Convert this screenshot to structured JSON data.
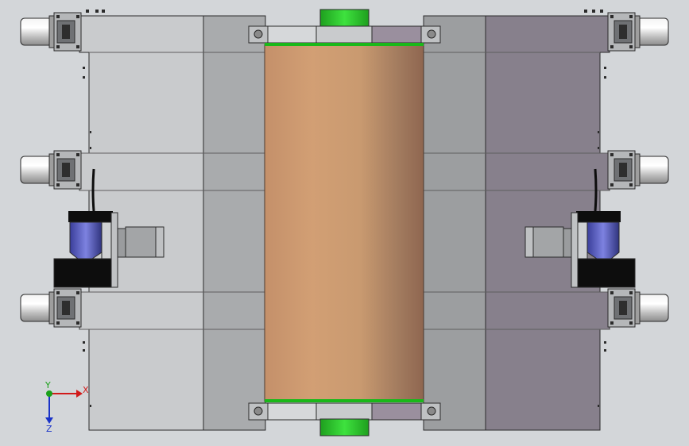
{
  "view": {
    "background": "#d3d6d9",
    "outline": "#2b2b2b"
  },
  "panels": {
    "left_outer": "#c9cbcd",
    "left_inner": "#a9abad",
    "right_inner": "#9c9ea0",
    "right_outer": "#87808c"
  },
  "roller": {
    "colors": [
      "#c4906a",
      "#d29f74",
      "#c99a70",
      "#a17a5e",
      "#8f6650"
    ],
    "shaft_color": "#2ecc2e",
    "band_color": "#19b819"
  },
  "motors": {
    "body_color": "#4d51b8",
    "housing_color": "#0d0d0d",
    "cylinder_color": "#e4e4e4"
  },
  "triad": {
    "x_label": "X",
    "y_label": "Y",
    "z_label": "Z",
    "x_color": "#d11a1a",
    "y_color": "#1aa01a",
    "z_color": "#1a33c8"
  }
}
